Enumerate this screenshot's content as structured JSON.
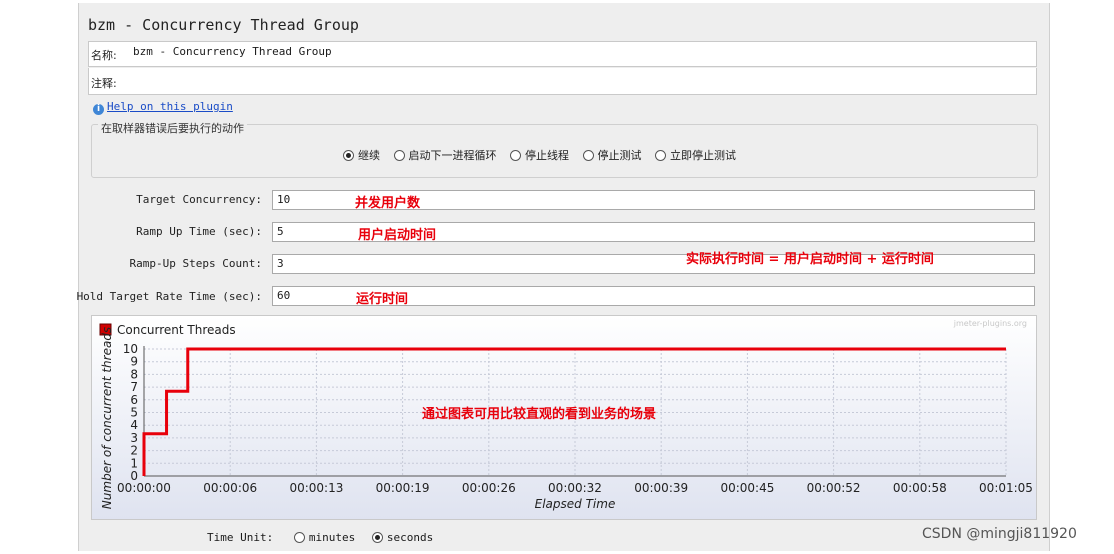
{
  "window": {
    "title": "bzm - Concurrency Thread Group"
  },
  "form": {
    "name_label": "名称:",
    "name_value": "bzm - Concurrency Thread Group",
    "comment_label": "注释:",
    "comment_value": "",
    "help_link": "Help on this plugin"
  },
  "error_action": {
    "title": "在取样器错误后要执行的动作",
    "options": [
      "继续",
      "启动下一进程循环",
      "停止线程",
      "停止测试",
      "立即停止测试"
    ],
    "selected": "继续"
  },
  "params": [
    {
      "label": "Target Concurrency:",
      "value": "10",
      "note": "并发用户数"
    },
    {
      "label": "Ramp Up Time (sec):",
      "value": "5",
      "note": "用户启动时间"
    },
    {
      "label": "Ramp-Up Steps Count:",
      "value": "3",
      "note": "实际执行时间 = 用户启动时间 + 运行时间"
    },
    {
      "label": "Hold Target Rate Time (sec):",
      "value": "60",
      "note": "运行时间"
    }
  ],
  "chart_caption": "通过图表可用比较直观的看到业务的场景",
  "chart_data": {
    "type": "line",
    "title": "Concurrent Threads",
    "watermark": "jmeter-plugins.org",
    "xlabel": "Elapsed Time",
    "ylabel": "Number of concurrent threads",
    "ylim": [
      0,
      10
    ],
    "y_ticks": [
      "0",
      "1",
      "2",
      "3",
      "4",
      "5",
      "6",
      "7",
      "8",
      "9",
      "10"
    ],
    "x_ticks": [
      "00:00:00",
      "00:00:06",
      "00:00:13",
      "00:00:19",
      "00:00:26",
      "00:00:32",
      "00:00:39",
      "00:00:45",
      "00:00:52",
      "00:00:58",
      "00:01:05"
    ],
    "xlim_sec": [
      0,
      65
    ],
    "series": [
      {
        "name": "Concurrent Threads",
        "color": "#e8000b",
        "x_sec": [
          0,
          0,
          1.7,
          1.7,
          3.3,
          3.3,
          65
        ],
        "values": [
          0,
          3.33,
          3.33,
          6.67,
          6.67,
          10,
          10
        ]
      }
    ]
  },
  "time_unit": {
    "label": "Time Unit:",
    "options": [
      "minutes",
      "seconds"
    ],
    "selected": "seconds"
  },
  "watermark": "CSDN @mingji811920"
}
